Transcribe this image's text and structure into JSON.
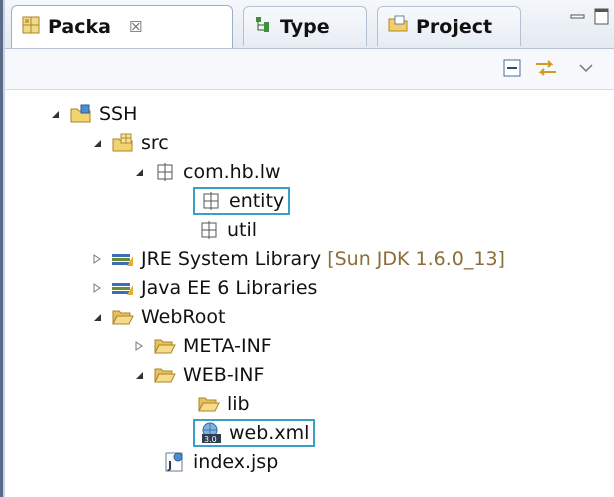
{
  "tabs": [
    {
      "label": "Packa",
      "close": "☒",
      "active": true
    },
    {
      "label": "Type",
      "active": false
    },
    {
      "label": "Project",
      "active": false
    }
  ],
  "tree": [
    {
      "label": "SSH",
      "depth": 0,
      "expanded": true,
      "icon": "project-icon"
    },
    {
      "label": "src",
      "depth": 1,
      "expanded": true,
      "icon": "source-folder-icon"
    },
    {
      "label": "com.hb.lw",
      "depth": 2,
      "expanded": true,
      "icon": "package-icon"
    },
    {
      "label": "entity",
      "depth": 3,
      "icon": "package-icon",
      "selected": true
    },
    {
      "label": "util",
      "depth": 3,
      "icon": "package-icon"
    },
    {
      "label": "JRE System Library",
      "decoration": "[Sun JDK 1.6.0_13]",
      "depth": 1,
      "expanded": false,
      "icon": "library-icon"
    },
    {
      "label": "Java EE 6 Libraries",
      "depth": 1,
      "expanded": false,
      "icon": "library-icon"
    },
    {
      "label": "WebRoot",
      "depth": 1,
      "expanded": true,
      "icon": "folder-icon"
    },
    {
      "label": "META-INF",
      "depth": 2,
      "expanded": false,
      "icon": "folder-icon"
    },
    {
      "label": "WEB-INF",
      "depth": 2,
      "expanded": true,
      "icon": "folder-icon"
    },
    {
      "label": "lib",
      "depth": 3,
      "icon": "folder-icon"
    },
    {
      "label": "web.xml",
      "depth": 3,
      "icon": "web-xml-icon",
      "selected": true
    },
    {
      "label": "index.jsp",
      "depth": 2,
      "icon": "jsp-icon"
    }
  ]
}
